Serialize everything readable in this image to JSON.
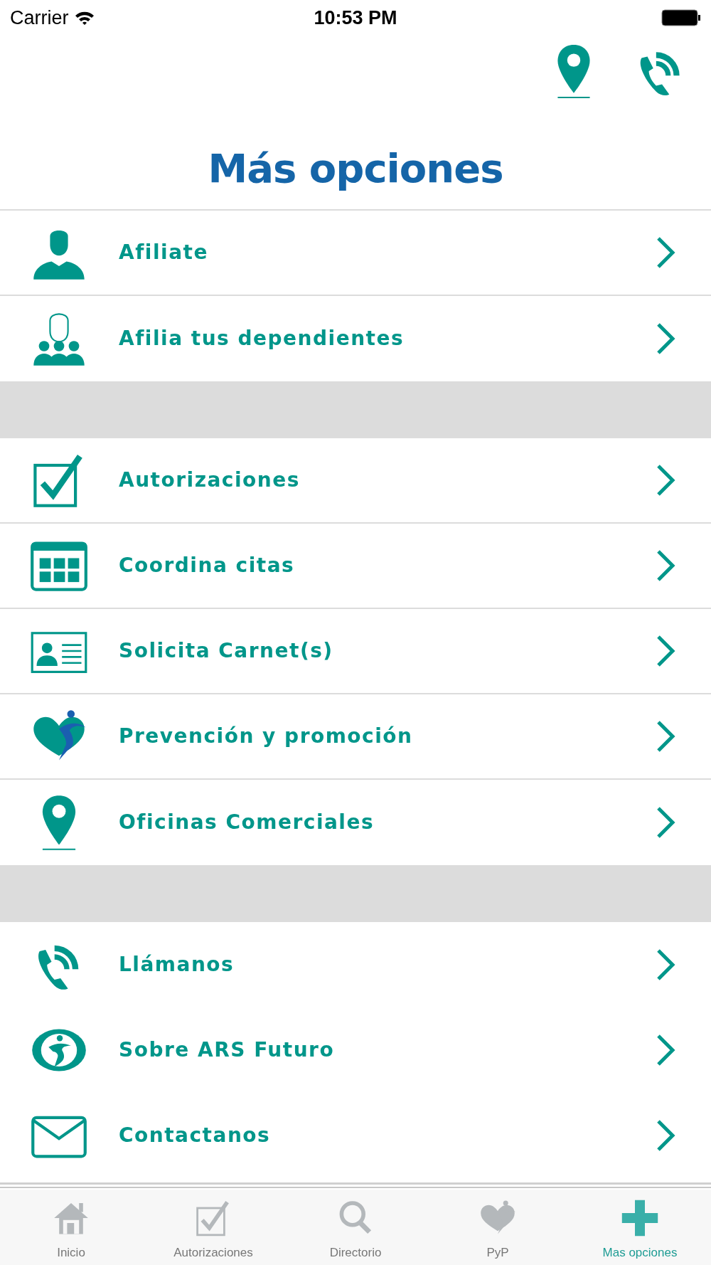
{
  "status_bar": {
    "carrier": "Carrier",
    "time": "10:53 PM"
  },
  "title": "Más opciones",
  "sections": [
    {
      "dividers": true,
      "rows": [
        {
          "label": "Afiliate",
          "kind": "person"
        },
        {
          "label": "Afilia tus dependientes",
          "kind": "group"
        }
      ]
    },
    {
      "dividers": true,
      "rows": [
        {
          "label": "Autorizaciones",
          "kind": "check"
        },
        {
          "label": "Coordina citas",
          "kind": "calendar"
        },
        {
          "label": "Solicita Carnet(s)",
          "kind": "card"
        },
        {
          "label": "Prevención y promoción",
          "kind": "pyp"
        },
        {
          "label": "Oficinas Comerciales",
          "kind": "pin"
        }
      ]
    },
    {
      "dividers": false,
      "rows": [
        {
          "label": "Llámanos",
          "kind": "phone"
        },
        {
          "label": "Sobre ARS Futuro",
          "kind": "logo"
        },
        {
          "label": "Contactanos",
          "kind": "mail"
        }
      ]
    }
  ],
  "tab_bar": [
    {
      "label": "Inicio",
      "kind": "home",
      "selected": false
    },
    {
      "label": "Autorizaciones",
      "kind": "check",
      "selected": false
    },
    {
      "label": "Directorio",
      "kind": "search",
      "selected": false
    },
    {
      "label": "PyP",
      "kind": "pyp",
      "selected": false
    },
    {
      "label": "Mas opciones",
      "kind": "plus",
      "selected": true
    }
  ]
}
